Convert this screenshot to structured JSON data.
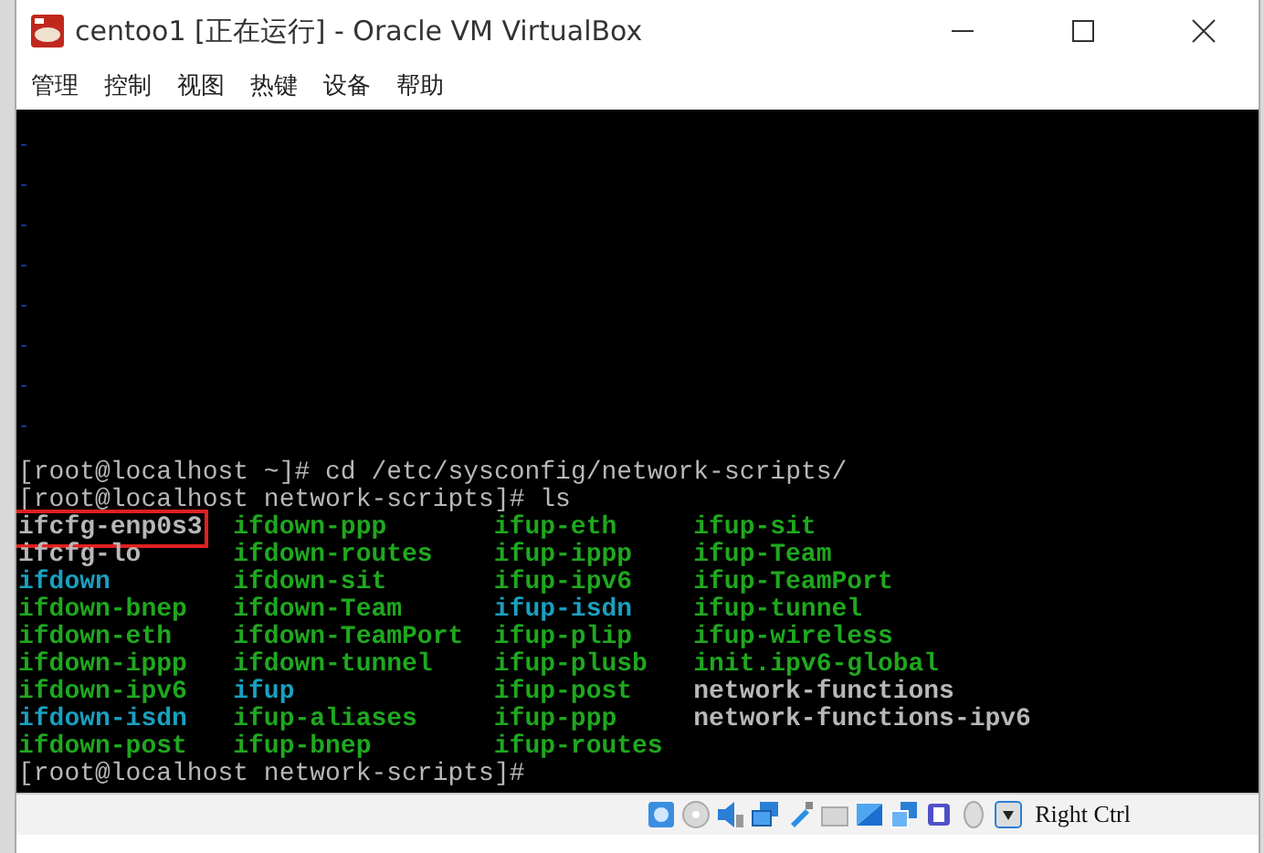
{
  "window": {
    "title": "centoo1 [正在运行] - Oracle VM VirtualBox"
  },
  "menu": [
    "管理",
    "控制",
    "视图",
    "热键",
    "设备",
    "帮助"
  ],
  "console": {
    "margin_marks": [
      "-",
      "-",
      "-",
      "-",
      "-",
      "-",
      "-",
      "-"
    ],
    "commands": [
      "[root@localhost ~]# cd /etc/sysconfig/network-scripts/",
      "[root@localhost network-scripts]# ls"
    ],
    "listing": [
      [
        {
          "name": "ifcfg-enp0s3",
          "kind": "file",
          "highlighted": true
        },
        {
          "name": "ifdown-ppp",
          "kind": "exec",
          "highlighted": false
        },
        {
          "name": "ifup-eth",
          "kind": "exec",
          "highlighted": false
        },
        {
          "name": "ifup-sit",
          "kind": "exec",
          "highlighted": false
        }
      ],
      [
        {
          "name": "ifcfg-lo",
          "kind": "file",
          "highlighted": false
        },
        {
          "name": "ifdown-routes",
          "kind": "exec",
          "highlighted": false
        },
        {
          "name": "ifup-ippp",
          "kind": "exec",
          "highlighted": false
        },
        {
          "name": "ifup-Team",
          "kind": "exec",
          "highlighted": false
        }
      ],
      [
        {
          "name": "ifdown",
          "kind": "link",
          "highlighted": false
        },
        {
          "name": "ifdown-sit",
          "kind": "exec",
          "highlighted": false
        },
        {
          "name": "ifup-ipv6",
          "kind": "exec",
          "highlighted": false
        },
        {
          "name": "ifup-TeamPort",
          "kind": "exec",
          "highlighted": false
        }
      ],
      [
        {
          "name": "ifdown-bnep",
          "kind": "exec",
          "highlighted": false
        },
        {
          "name": "ifdown-Team",
          "kind": "exec",
          "highlighted": false
        },
        {
          "name": "ifup-isdn",
          "kind": "link",
          "highlighted": false
        },
        {
          "name": "ifup-tunnel",
          "kind": "exec",
          "highlighted": false
        }
      ],
      [
        {
          "name": "ifdown-eth",
          "kind": "exec",
          "highlighted": false
        },
        {
          "name": "ifdown-TeamPort",
          "kind": "exec",
          "highlighted": false
        },
        {
          "name": "ifup-plip",
          "kind": "exec",
          "highlighted": false
        },
        {
          "name": "ifup-wireless",
          "kind": "exec",
          "highlighted": false
        }
      ],
      [
        {
          "name": "ifdown-ippp",
          "kind": "exec",
          "highlighted": false
        },
        {
          "name": "ifdown-tunnel",
          "kind": "exec",
          "highlighted": false
        },
        {
          "name": "ifup-plusb",
          "kind": "exec",
          "highlighted": false
        },
        {
          "name": "init.ipv6-global",
          "kind": "exec",
          "highlighted": false
        }
      ],
      [
        {
          "name": "ifdown-ipv6",
          "kind": "exec",
          "highlighted": false
        },
        {
          "name": "ifup",
          "kind": "link",
          "highlighted": false
        },
        {
          "name": "ifup-post",
          "kind": "exec",
          "highlighted": false
        },
        {
          "name": "network-functions",
          "kind": "file",
          "highlighted": false
        }
      ],
      [
        {
          "name": "ifdown-isdn",
          "kind": "link",
          "highlighted": false
        },
        {
          "name": "ifup-aliases",
          "kind": "exec",
          "highlighted": false
        },
        {
          "name": "ifup-ppp",
          "kind": "exec",
          "highlighted": false
        },
        {
          "name": "network-functions-ipv6",
          "kind": "file",
          "highlighted": false
        }
      ],
      [
        {
          "name": "ifdown-post",
          "kind": "exec",
          "highlighted": false
        },
        {
          "name": "ifup-bnep",
          "kind": "exec",
          "highlighted": false
        },
        {
          "name": "ifup-routes",
          "kind": "exec",
          "highlighted": false
        }
      ]
    ],
    "prompt": "[root@localhost network-scripts]#"
  },
  "status_bar": {
    "host_key": "Right Ctrl"
  }
}
